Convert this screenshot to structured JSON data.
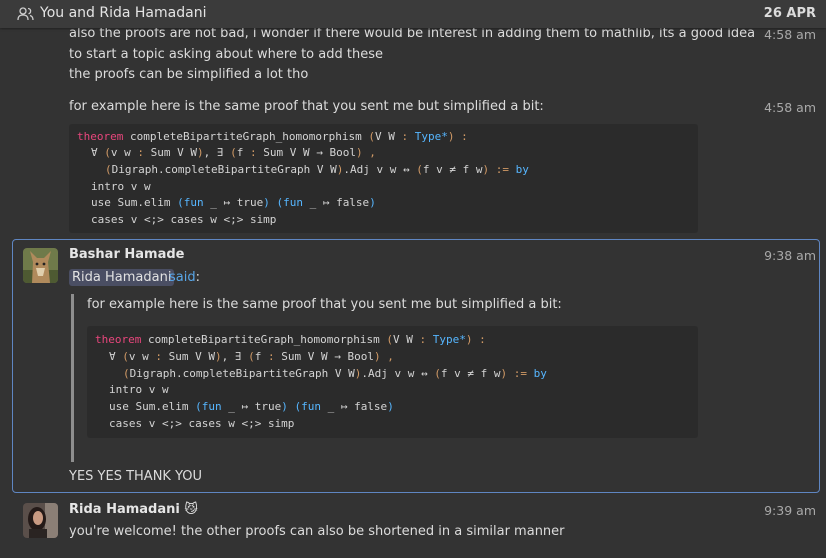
{
  "header": {
    "title": "You and Rida Hamadani",
    "date": "26 APR"
  },
  "earlier": {
    "lines": [
      "also the proofs are not bad, i wonder if there would be interest in adding them to mathlib, its a good idea",
      "to start a topic asking about where to add these",
      "the proofs can be simplified a lot tho"
    ],
    "time1": "4:58 am",
    "line4": "for example here is the same proof that you sent me but simplified a bit:",
    "time2": "4:58 am"
  },
  "code": {
    "l1": {
      "kw": "theorem",
      "t1": " completeBipartiteGraph_homomorphism ",
      "p1": "(",
      "t2": "V W ",
      "p2": ":",
      "t3": " ",
      "ty": "Type*",
      "p3": ")",
      "t4": " ",
      "p4": ":"
    },
    "l2": {
      "t1": "∀ ",
      "p1": "(",
      "t2": "v w ",
      "p2": ":",
      "t3": " Sum V W",
      "p3": ")",
      "t4": ", ∃ ",
      "p5": "(",
      "t5": "f ",
      "p6": ":",
      "t6": " Sum V W → Bool",
      "p7": ")",
      "t7": " ",
      "p8": ","
    },
    "l3": {
      "p1": "(",
      "t1": "Digraph.completeBipartiteGraph V W",
      "p2": ")",
      "t2": ".Adj v w ↔ ",
      "p3": "(",
      "t3": "f v ≠ f w",
      "p4": ")",
      "t4": " ",
      "p5": ":=",
      "t5": " ",
      "by": "by"
    },
    "l4": "intro v w",
    "l5": {
      "t1": "use Sum.elim ",
      "p1": "(",
      "fun1": "fun",
      "t2": " _ ↦ true",
      "p2": ")",
      "t3": " ",
      "p3": "(",
      "fun2": "fun",
      "t4": " _ ↦ false",
      "p4": ")"
    },
    "l6": "cases v <;> cases w <;> simp"
  },
  "message_bashar": {
    "sender": "Bashar Hamade",
    "time": "9:38 am",
    "mention": "Rida Hamadani",
    "said": "said",
    "colon": ":",
    "quote_text": "for example here is the same proof that you sent me but simplified a bit:",
    "reply": "YES YES THANK YOU"
  },
  "message_rida": {
    "sender": "Rida Hamadani",
    "emoji": "😼",
    "time": "9:39 am",
    "text": "you're welcome! the other proofs can also be shortened in a similar manner"
  }
}
